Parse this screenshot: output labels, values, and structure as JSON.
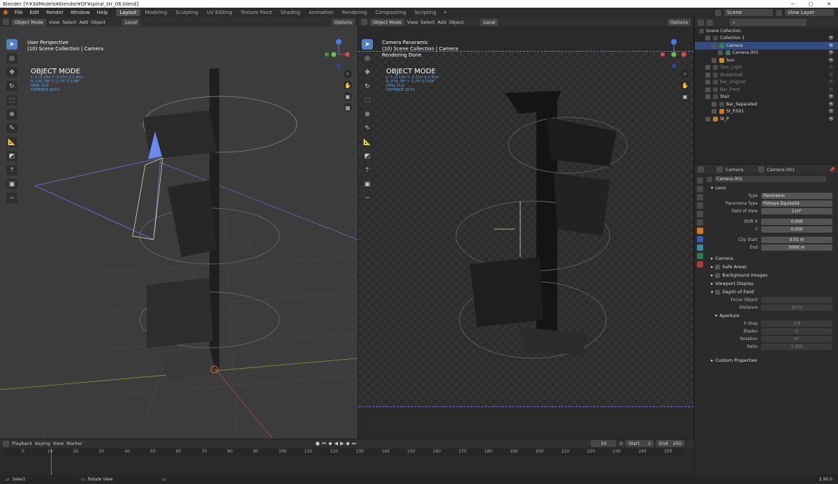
{
  "window": {
    "title": "Blender [Y:¥3dModels¥blender¥GF¥spiral_str_06.blend]"
  },
  "menu": [
    "File",
    "Edit",
    "Render",
    "Window",
    "Help"
  ],
  "workspaces": [
    "Layout",
    "Modeling",
    "Sculpting",
    "UV Editing",
    "Texture Paint",
    "Shading",
    "Animation",
    "Rendering",
    "Compositing",
    "Scripting"
  ],
  "active_workspace": "Layout",
  "scene": {
    "label": "Scene",
    "view_layer": "View Layer"
  },
  "left_viewport": {
    "mode_btn": "Object Mode",
    "menus": [
      "View",
      "Select",
      "Add",
      "Object"
    ],
    "pivot": "Local",
    "options": "Options",
    "title": "User Perspective",
    "subtitle": "(10) Scene Collection | Camera",
    "mode_text": "OBJECT MODE",
    "l_coords": "L: X -0.13m Y -2.27m Z 2.45m",
    "r_coords": "R: X 81.38° Y -2.73° Z 3.58°",
    "lens": "LENS 10.0",
    "distance": "DISTANCE 18.52"
  },
  "right_viewport": {
    "mode_btn": "Object Mode",
    "menus": [
      "View",
      "Select",
      "Add",
      "Object"
    ],
    "pivot": "Local",
    "options": "Options",
    "title": "Camera Panoramic",
    "subtitle": "(10) Scene Collection | Camera",
    "status": "Rendering Done",
    "mode_text": "OBJECT MODE",
    "l_coords": "L: X -0.13m Y -2.27m Z 2.45m",
    "r_coords": "R: X 81.38° Y -2.73° Z 3.58°",
    "lens": "LENS 10.0",
    "distance": "DISTANCE 18.52"
  },
  "outliner": {
    "root": "Scene Collection",
    "rows": [
      {
        "label": "Collection 1",
        "indent": 1,
        "dim": false,
        "sel": false
      },
      {
        "label": "Camera",
        "indent": 2,
        "dim": false,
        "sel": true
      },
      {
        "label": "Camera.001",
        "indent": 3,
        "dim": false,
        "sel": false
      },
      {
        "label": "Sun",
        "indent": 2,
        "dim": false,
        "sel": false
      },
      {
        "label": "Toon_Light",
        "indent": 1,
        "dim": true,
        "sel": false
      },
      {
        "label": "Shaderball",
        "indent": 1,
        "dim": true,
        "sel": false
      },
      {
        "label": "Bar_Original",
        "indent": 1,
        "dim": true,
        "sel": false
      },
      {
        "label": "Bar_Front",
        "indent": 1,
        "dim": true,
        "sel": false
      },
      {
        "label": "Stair",
        "indent": 1,
        "dim": false,
        "sel": false
      },
      {
        "label": "Bar_Separated",
        "indent": 2,
        "dim": false,
        "sel": false
      },
      {
        "label": "St_P.001",
        "indent": 2,
        "dim": false,
        "sel": false
      },
      {
        "label": "St_P",
        "indent": 1,
        "dim": false,
        "sel": false
      }
    ]
  },
  "properties": {
    "breadcrumb_obj": "Camera",
    "breadcrumb_data": "Camera.001",
    "data_name": "Camera.001",
    "lens_section": "Lens",
    "fields": [
      {
        "label": "Type",
        "value": "Panoramic",
        "dark": false,
        "left": true
      },
      {
        "label": "Panorama Type",
        "value": "Fisheye Equisolid",
        "dark": false,
        "left": true
      },
      {
        "label": "Field of View",
        "value": "110°",
        "dark": false,
        "left": false
      },
      {
        "label": "Shift X",
        "value": "0.000",
        "dark": false,
        "left": false
      },
      {
        "label": "Y",
        "value": "0.000",
        "dark": false,
        "left": false
      },
      {
        "label": "Clip Start",
        "value": "0.01 m",
        "dark": false,
        "left": false
      },
      {
        "label": "End",
        "value": "5000 m",
        "dark": false,
        "left": false
      }
    ],
    "sections": [
      "Camera",
      "Safe Areas",
      "Background Images",
      "Viewport Display",
      "Depth of Field"
    ],
    "dof_fields": [
      {
        "label": "Focus Object",
        "value": "",
        "left": true
      },
      {
        "label": "Distance",
        "value": "10 m",
        "left": false
      }
    ],
    "aperture": "Aperture",
    "aperture_fields": [
      {
        "label": "F-Stop",
        "value": "2.8"
      },
      {
        "label": "Blades",
        "value": "0"
      },
      {
        "label": "Rotation",
        "value": "0°"
      },
      {
        "label": "Ratio",
        "value": "1.000"
      }
    ],
    "custom": "Custom Properties"
  },
  "timeline": {
    "menus": [
      "Playback",
      "Keying",
      "View",
      "Marker"
    ],
    "current": "10",
    "start_label": "Start",
    "start": "1",
    "end_label": "End",
    "end": "250",
    "ticks": [
      0,
      10,
      20,
      30,
      40,
      50,
      60,
      70,
      80,
      90,
      100,
      110,
      120,
      130,
      140,
      150,
      160,
      170,
      180,
      190,
      200,
      210,
      220,
      230,
      240,
      250
    ]
  },
  "status": {
    "select": "Select",
    "rotate": "Rotate View",
    "version": "2.90.0"
  }
}
